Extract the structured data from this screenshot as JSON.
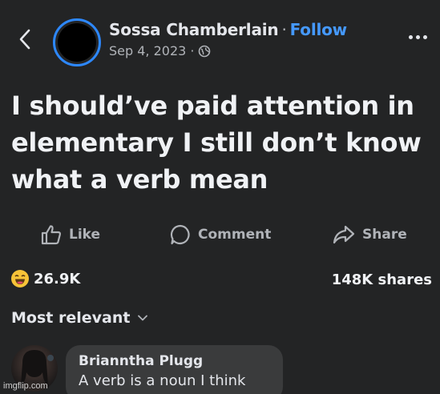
{
  "header": {
    "author": "Sossa Chamberlain",
    "separator": "·",
    "follow_label": "Follow",
    "date": "Sep 4, 2023",
    "meta_separator": "·",
    "audience_icon": "globe-icon"
  },
  "post": {
    "text": "I should’ve paid attention in elementary I still don’t know what a verb mean"
  },
  "actions": {
    "like_label": "Like",
    "comment_label": "Comment",
    "share_label": "Share"
  },
  "stats": {
    "reaction_icon": "laughing-emoji-icon",
    "reaction_count": "26.9K",
    "shares": "148K shares"
  },
  "comments": {
    "sort_label": "Most relevant",
    "items": [
      {
        "author": "Brianntha Plugg",
        "text": "A verb is a noun I think"
      }
    ]
  },
  "watermark": "imgflip.com",
  "colors": {
    "background": "#232425",
    "accent": "#4599ff",
    "bubble": "#3a3b3c"
  }
}
